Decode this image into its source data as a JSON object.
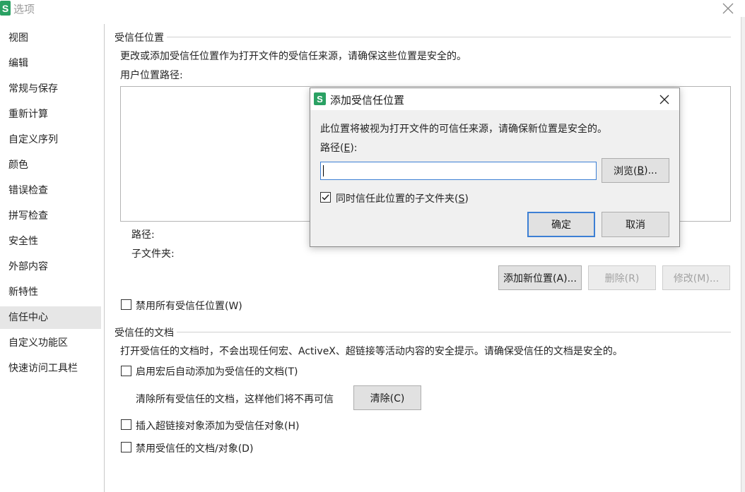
{
  "window": {
    "title": "选项",
    "logo_letter": "S"
  },
  "sidebar": {
    "items": [
      {
        "label": "视图"
      },
      {
        "label": "编辑"
      },
      {
        "label": "常规与保存"
      },
      {
        "label": "重新计算"
      },
      {
        "label": "自定义序列"
      },
      {
        "label": "颜色"
      },
      {
        "label": "错误检查"
      },
      {
        "label": "拼写检查"
      },
      {
        "label": "安全性"
      },
      {
        "label": "外部内容"
      },
      {
        "label": "新特性"
      },
      {
        "label": "信任中心",
        "active": true
      },
      {
        "label": "自定义功能区"
      },
      {
        "label": "快速访问工具栏"
      }
    ]
  },
  "trusted_locations": {
    "header": "受信任位置",
    "description": "更改或添加受信任位置作为打开文件的受信任来源，请确保这些位置是安全的。",
    "user_paths_label": "用户位置路径:",
    "path_label": "路径:",
    "subfolder_label": "子文件夹:",
    "add_button": "添加新位置(A)...",
    "delete_button": "删除(R)",
    "modify_button": "修改(M)...",
    "disable_all_label": "禁用所有受信任位置(W)",
    "disable_all_checked": false
  },
  "trusted_docs": {
    "header": "受信任的文档",
    "description": "打开受信任的文档时，不会出现任何宏、ActiveX、超链接等活动内容的安全提示。请确保受信任的文档是安全的。",
    "enable_macro_label": "启用宏后自动添加为受信任的文档(T)",
    "enable_macro_checked": false,
    "clear_text": "清除所有受信任的文档，这样他们将不再可信",
    "clear_button": "清除(C)",
    "hyperlink_label": "插入超链接对象添加为受信任对象(H)",
    "hyperlink_checked": false,
    "disable_docs_label": "禁用受信任的文档/对象(D)",
    "disable_docs_checked": false
  },
  "dialog": {
    "title": "添加受信任位置",
    "message": "此位置将被视为打开文件的可信任来源，请确保新位置是安全的。",
    "path_label_prefix": "路径(",
    "path_label_key": "E",
    "path_label_suffix": "):",
    "path_value": "",
    "browse_prefix": "浏览(",
    "browse_key": "B",
    "browse_suffix": ")...",
    "subfolder_prefix": "同时信任此位置的子文件夹(",
    "subfolder_key": "S",
    "subfolder_suffix": ")",
    "subfolder_checked": true,
    "ok_button": "确定",
    "cancel_button": "取消"
  },
  "colors": {
    "accent": "#3c7fd4",
    "brand": "#2aa163"
  }
}
